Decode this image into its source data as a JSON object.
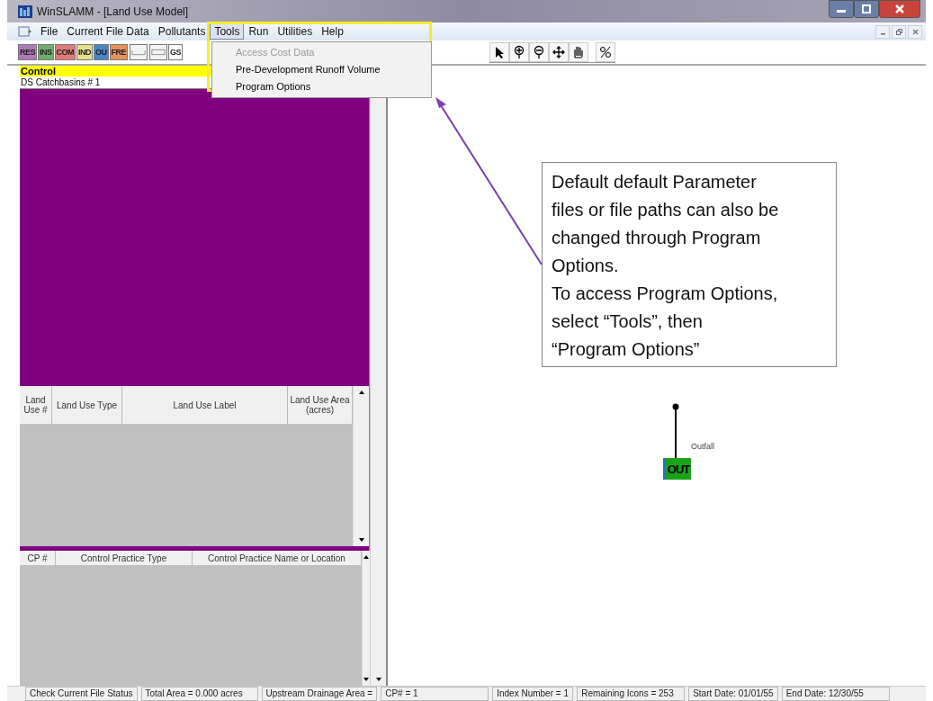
{
  "window": {
    "title": "WinSLAMM - [Land Use Model]"
  },
  "menu": [
    {
      "label": "File",
      "selected": false
    },
    {
      "label": "Current File Data",
      "selected": false
    },
    {
      "label": "Pollutants",
      "selected": false
    },
    {
      "label": "Tools",
      "selected": true
    },
    {
      "label": "Run",
      "selected": false
    },
    {
      "label": "Utilities",
      "selected": false
    },
    {
      "label": "Help",
      "selected": false
    }
  ],
  "dropdown": [
    {
      "label": "Access Cost Data",
      "disabled": true
    },
    {
      "label": "Pre-Development Runoff Volume",
      "disabled": false
    },
    {
      "label": "Program Options",
      "disabled": false
    }
  ],
  "toolbar": [
    {
      "label": "RES",
      "color": "#b07ab8"
    },
    {
      "label": "INS",
      "color": "#6fae6a"
    },
    {
      "label": "COM",
      "color": "#e07a7a"
    },
    {
      "label": "IND",
      "color": "#e6e08a"
    },
    {
      "label": "OU",
      "color": "#4a86c8"
    },
    {
      "label": "FRE",
      "color": "#e8925a"
    },
    {
      "label": "GS",
      "color": "#ffffff"
    }
  ],
  "control": {
    "label": "Control",
    "value": "DS Catchbasins # 1"
  },
  "land_use_table": {
    "columns": [
      "Land Use #",
      "Land Use Type",
      "Land Use Label",
      "Land Use Area (acres)"
    ]
  },
  "control_practice_table": {
    "columns": [
      "CP #",
      "Control Practice Type",
      "Control Practice Name or Location"
    ]
  },
  "canvas": {
    "node": {
      "label": "OUT",
      "name": "Outfall"
    }
  },
  "callout": [
    "Default default Parameter",
    "files or file paths can also be",
    "changed through Program",
    "Options.",
    "To access Program Options,",
    "select “Tools”, then",
    "“Program Options”"
  ],
  "status_bar": [
    "Check Current File Status",
    "Total Area = 0.000 acres",
    "Upstream Drainage Area =",
    "CP# = 1",
    "Index Number = 1",
    "Remaining Icons =  253",
    "Start Date:  01/01/55",
    "End Date:  12/30/55"
  ]
}
